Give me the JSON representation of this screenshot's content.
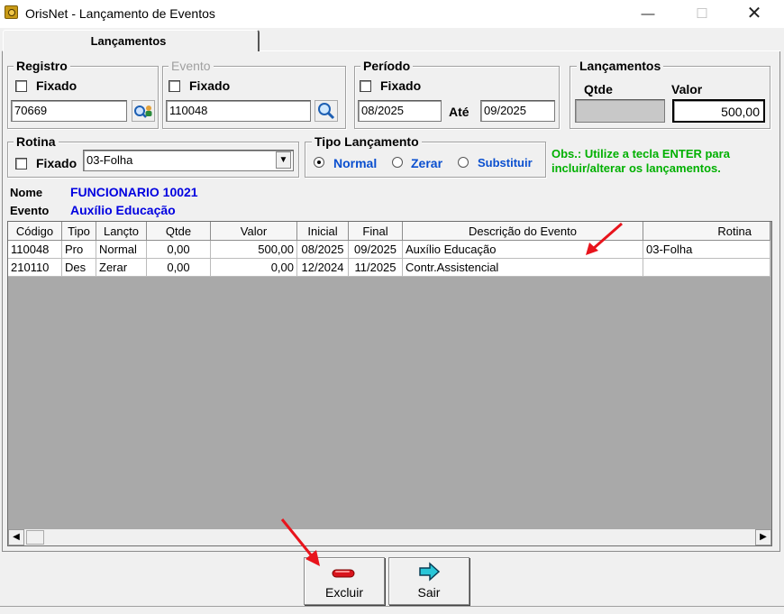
{
  "window": {
    "title": "OrisNet - Lançamento de Eventos"
  },
  "tabs": [
    {
      "label": "Lançamentos"
    }
  ],
  "registro": {
    "title": "Registro",
    "fixado_label": "Fixado",
    "value": "70669"
  },
  "evento": {
    "title": "Evento",
    "fixado_label": "Fixado",
    "value": "110048"
  },
  "periodo": {
    "title": "Período",
    "fixado_label": "Fixado",
    "from": "08/2025",
    "ate_label": "Até",
    "to": "09/2025"
  },
  "lancamentos_box": {
    "title": "Lançamentos",
    "qtde_label": "Qtde",
    "valor_label": "Valor",
    "qtde": "",
    "valor": "500,00"
  },
  "rotina": {
    "title": "Rotina",
    "fixado_label": "Fixado",
    "selected": "03-Folha"
  },
  "tipo_lancamento": {
    "title": "Tipo Lançamento",
    "options": [
      {
        "label": "Normal",
        "checked": true
      },
      {
        "label": "Zerar",
        "checked": false
      },
      {
        "label": "Substituir",
        "checked": false
      }
    ]
  },
  "obs": {
    "line1": "Obs.: Utilize a tecla ENTER para",
    "line2": "incluir/alterar os lançamentos."
  },
  "info": {
    "nome_label": "Nome",
    "nome": "FUNCIONARIO 10021",
    "evento_label": "Evento",
    "evento": "Auxílio Educação"
  },
  "grid": {
    "columns": [
      "Código",
      "Tipo",
      "Lançto",
      "Qtde",
      "Valor",
      "Inicial",
      "Final",
      "Descrição do Evento",
      "Rotina"
    ],
    "rows": [
      [
        "110048",
        "Pro",
        "Normal",
        "0,00",
        "500,00",
        "08/2025",
        "09/2025",
        "Auxílio Educação",
        "03-Folha"
      ],
      [
        "210110",
        "Des",
        "Zerar",
        "0,00",
        "0,00",
        "12/2024",
        "11/2025",
        "Contr.Assistencial",
        ""
      ]
    ]
  },
  "buttons": {
    "excluir": "Excluir",
    "sair": "Sair"
  },
  "colors": {
    "annotation_arrow": "#e8141c",
    "obs_text": "#00b000",
    "info_text": "#0000e0"
  }
}
